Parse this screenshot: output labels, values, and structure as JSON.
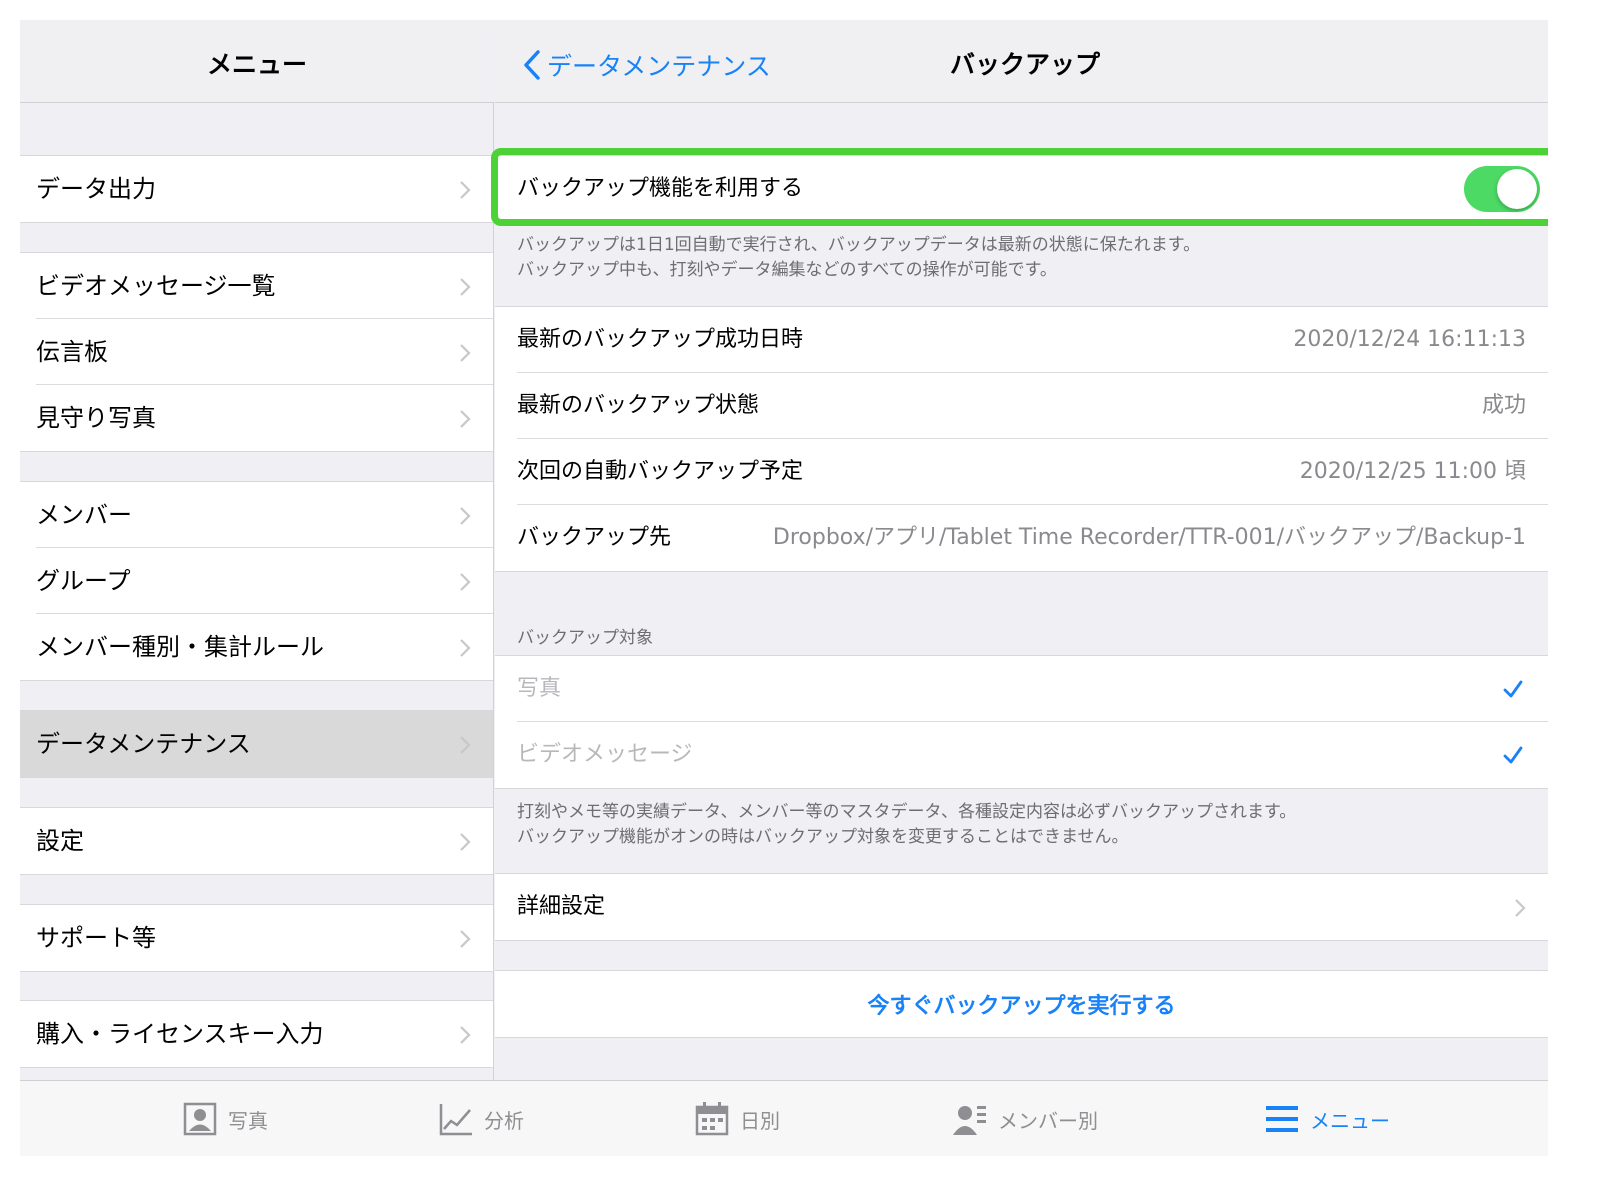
{
  "sidebar": {
    "title": "メニュー",
    "groups": [
      {
        "items": [
          {
            "label": "データ出力"
          }
        ]
      },
      {
        "items": [
          {
            "label": "ビデオメッセージ一覧"
          },
          {
            "label": "伝言板"
          },
          {
            "label": "見守り写真"
          }
        ]
      },
      {
        "items": [
          {
            "label": "メンバー"
          },
          {
            "label": "グループ"
          },
          {
            "label": "メンバー種別・集計ルール"
          }
        ]
      },
      {
        "items": [
          {
            "label": "データメンテナンス",
            "selected": true
          }
        ]
      },
      {
        "items": [
          {
            "label": "設定"
          }
        ]
      },
      {
        "items": [
          {
            "label": "サポート等"
          }
        ]
      },
      {
        "items": [
          {
            "label": "購入・ライセンスキー入力"
          }
        ]
      }
    ]
  },
  "detail": {
    "back_label": "データメンテナンス",
    "title": "バックアップ",
    "toggle": {
      "label": "バックアップ機能を利用する",
      "on": true
    },
    "toggle_note": [
      "バックアップは1日1回自動で実行され、バックアップデータは最新の状態に保たれます。",
      "バックアップ中も、打刻やデータ編集などのすべての操作が可能です。"
    ],
    "status_rows": [
      {
        "label": "最新のバックアップ成功日時",
        "value": "2020/12/24 16:11:13"
      },
      {
        "label": "最新のバックアップ状態",
        "value": "成功"
      },
      {
        "label": "次回の自動バックアップ予定",
        "value": "2020/12/25 11:00 頃"
      },
      {
        "label": "バックアップ先",
        "value": "Dropbox/アプリ/Tablet Time Recorder/TTR-001/バックアップ/Backup-1"
      }
    ],
    "targets_header": "バックアップ対象",
    "targets": [
      {
        "label": "写真",
        "checked": true
      },
      {
        "label": "ビデオメッセージ",
        "checked": true
      }
    ],
    "targets_note": [
      "打刻やメモ等の実績データ、メンバー等のマスタデータ、各種設定内容は必ずバックアップされます。",
      "バックアップ機能がオンの時はバックアップ対象を変更することはできません。"
    ],
    "advanced_label": "詳細設定",
    "run_now_label": "今すぐバックアップを実行する"
  },
  "tabbar": {
    "tabs": [
      {
        "label": "写真",
        "icon": "portrait-photo-icon",
        "active": false
      },
      {
        "label": "分析",
        "icon": "line-chart-icon",
        "active": false
      },
      {
        "label": "日別",
        "icon": "calendar-icon",
        "active": false
      },
      {
        "label": "メンバー別",
        "icon": "person-list-icon",
        "active": false
      },
      {
        "label": "メニュー",
        "icon": "hamburger-menu-icon",
        "active": true
      }
    ]
  },
  "colors": {
    "accent": "#1a82f7",
    "toggle_on": "#4cd964",
    "highlight": "#4cd137",
    "background": "#efeff4"
  }
}
